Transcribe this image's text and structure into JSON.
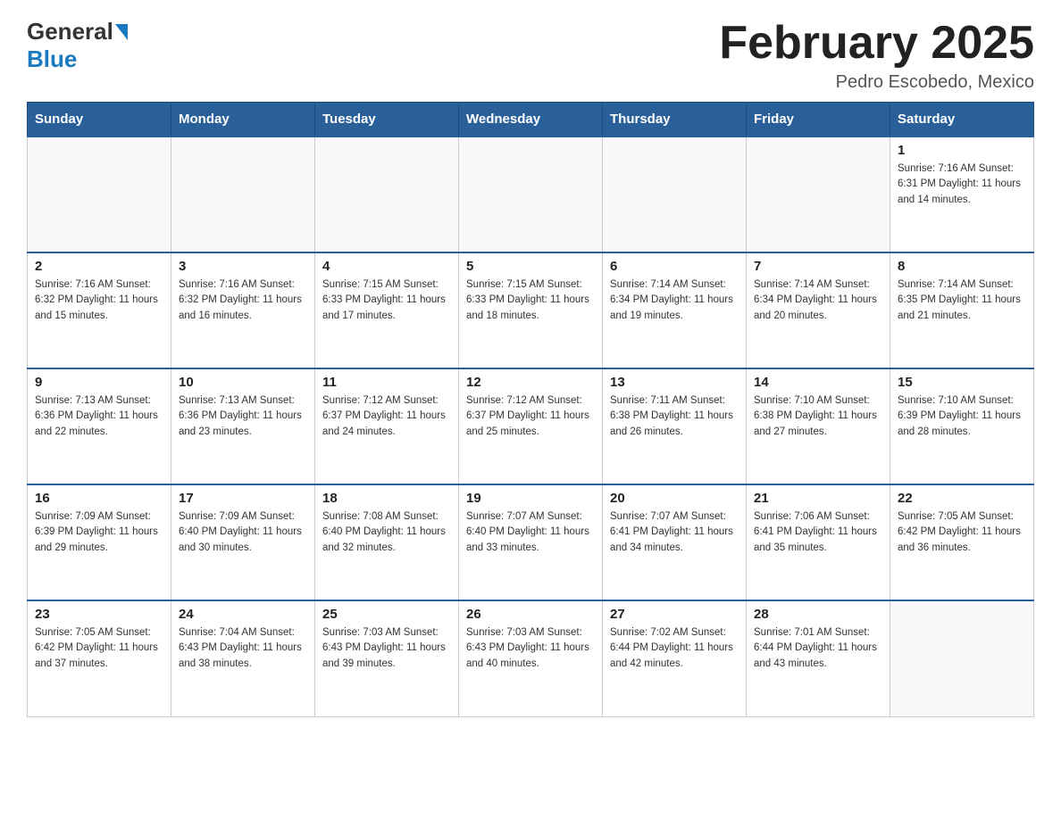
{
  "header": {
    "logo": {
      "general": "General",
      "arrow": "▶",
      "blue": "Blue"
    },
    "title": "February 2025",
    "location": "Pedro Escobedo, Mexico"
  },
  "days_of_week": [
    "Sunday",
    "Monday",
    "Tuesday",
    "Wednesday",
    "Thursday",
    "Friday",
    "Saturday"
  ],
  "weeks": [
    [
      {
        "day": "",
        "info": ""
      },
      {
        "day": "",
        "info": ""
      },
      {
        "day": "",
        "info": ""
      },
      {
        "day": "",
        "info": ""
      },
      {
        "day": "",
        "info": ""
      },
      {
        "day": "",
        "info": ""
      },
      {
        "day": "1",
        "info": "Sunrise: 7:16 AM\nSunset: 6:31 PM\nDaylight: 11 hours\nand 14 minutes."
      }
    ],
    [
      {
        "day": "2",
        "info": "Sunrise: 7:16 AM\nSunset: 6:32 PM\nDaylight: 11 hours\nand 15 minutes."
      },
      {
        "day": "3",
        "info": "Sunrise: 7:16 AM\nSunset: 6:32 PM\nDaylight: 11 hours\nand 16 minutes."
      },
      {
        "day": "4",
        "info": "Sunrise: 7:15 AM\nSunset: 6:33 PM\nDaylight: 11 hours\nand 17 minutes."
      },
      {
        "day": "5",
        "info": "Sunrise: 7:15 AM\nSunset: 6:33 PM\nDaylight: 11 hours\nand 18 minutes."
      },
      {
        "day": "6",
        "info": "Sunrise: 7:14 AM\nSunset: 6:34 PM\nDaylight: 11 hours\nand 19 minutes."
      },
      {
        "day": "7",
        "info": "Sunrise: 7:14 AM\nSunset: 6:34 PM\nDaylight: 11 hours\nand 20 minutes."
      },
      {
        "day": "8",
        "info": "Sunrise: 7:14 AM\nSunset: 6:35 PM\nDaylight: 11 hours\nand 21 minutes."
      }
    ],
    [
      {
        "day": "9",
        "info": "Sunrise: 7:13 AM\nSunset: 6:36 PM\nDaylight: 11 hours\nand 22 minutes."
      },
      {
        "day": "10",
        "info": "Sunrise: 7:13 AM\nSunset: 6:36 PM\nDaylight: 11 hours\nand 23 minutes."
      },
      {
        "day": "11",
        "info": "Sunrise: 7:12 AM\nSunset: 6:37 PM\nDaylight: 11 hours\nand 24 minutes."
      },
      {
        "day": "12",
        "info": "Sunrise: 7:12 AM\nSunset: 6:37 PM\nDaylight: 11 hours\nand 25 minutes."
      },
      {
        "day": "13",
        "info": "Sunrise: 7:11 AM\nSunset: 6:38 PM\nDaylight: 11 hours\nand 26 minutes."
      },
      {
        "day": "14",
        "info": "Sunrise: 7:10 AM\nSunset: 6:38 PM\nDaylight: 11 hours\nand 27 minutes."
      },
      {
        "day": "15",
        "info": "Sunrise: 7:10 AM\nSunset: 6:39 PM\nDaylight: 11 hours\nand 28 minutes."
      }
    ],
    [
      {
        "day": "16",
        "info": "Sunrise: 7:09 AM\nSunset: 6:39 PM\nDaylight: 11 hours\nand 29 minutes."
      },
      {
        "day": "17",
        "info": "Sunrise: 7:09 AM\nSunset: 6:40 PM\nDaylight: 11 hours\nand 30 minutes."
      },
      {
        "day": "18",
        "info": "Sunrise: 7:08 AM\nSunset: 6:40 PM\nDaylight: 11 hours\nand 32 minutes."
      },
      {
        "day": "19",
        "info": "Sunrise: 7:07 AM\nSunset: 6:40 PM\nDaylight: 11 hours\nand 33 minutes."
      },
      {
        "day": "20",
        "info": "Sunrise: 7:07 AM\nSunset: 6:41 PM\nDaylight: 11 hours\nand 34 minutes."
      },
      {
        "day": "21",
        "info": "Sunrise: 7:06 AM\nSunset: 6:41 PM\nDaylight: 11 hours\nand 35 minutes."
      },
      {
        "day": "22",
        "info": "Sunrise: 7:05 AM\nSunset: 6:42 PM\nDaylight: 11 hours\nand 36 minutes."
      }
    ],
    [
      {
        "day": "23",
        "info": "Sunrise: 7:05 AM\nSunset: 6:42 PM\nDaylight: 11 hours\nand 37 minutes."
      },
      {
        "day": "24",
        "info": "Sunrise: 7:04 AM\nSunset: 6:43 PM\nDaylight: 11 hours\nand 38 minutes."
      },
      {
        "day": "25",
        "info": "Sunrise: 7:03 AM\nSunset: 6:43 PM\nDaylight: 11 hours\nand 39 minutes."
      },
      {
        "day": "26",
        "info": "Sunrise: 7:03 AM\nSunset: 6:43 PM\nDaylight: 11 hours\nand 40 minutes."
      },
      {
        "day": "27",
        "info": "Sunrise: 7:02 AM\nSunset: 6:44 PM\nDaylight: 11 hours\nand 42 minutes."
      },
      {
        "day": "28",
        "info": "Sunrise: 7:01 AM\nSunset: 6:44 PM\nDaylight: 11 hours\nand 43 minutes."
      },
      {
        "day": "",
        "info": ""
      }
    ]
  ]
}
